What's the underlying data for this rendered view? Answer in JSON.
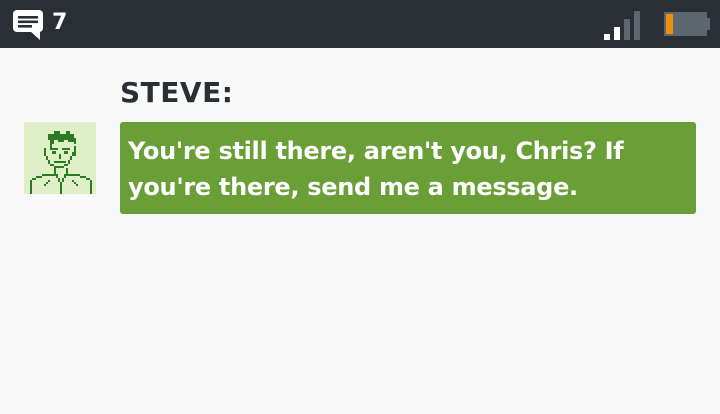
{
  "status_bar": {
    "message_icon": "chat-bubble-icon",
    "unread_count": "7",
    "signal_icon": "signal-strength-icon",
    "signal_bars_active": 2,
    "signal_bars_total": 4,
    "battery_icon": "battery-low-icon",
    "battery_level": 0.15,
    "battery_color": "#f0900a"
  },
  "conversation": {
    "speaker": "STEVE:",
    "avatar_icon": "pixel-portrait-steve",
    "message": "You're still there, aren't you, Chris? If you're there, send me a message."
  },
  "colors": {
    "status_bar_bg": "#2a2f36",
    "background": "#f9f9f9",
    "bubble_bg": "#6a9e37",
    "avatar_bg": "#dff0c8",
    "avatar_ink": "#2d7a24"
  }
}
